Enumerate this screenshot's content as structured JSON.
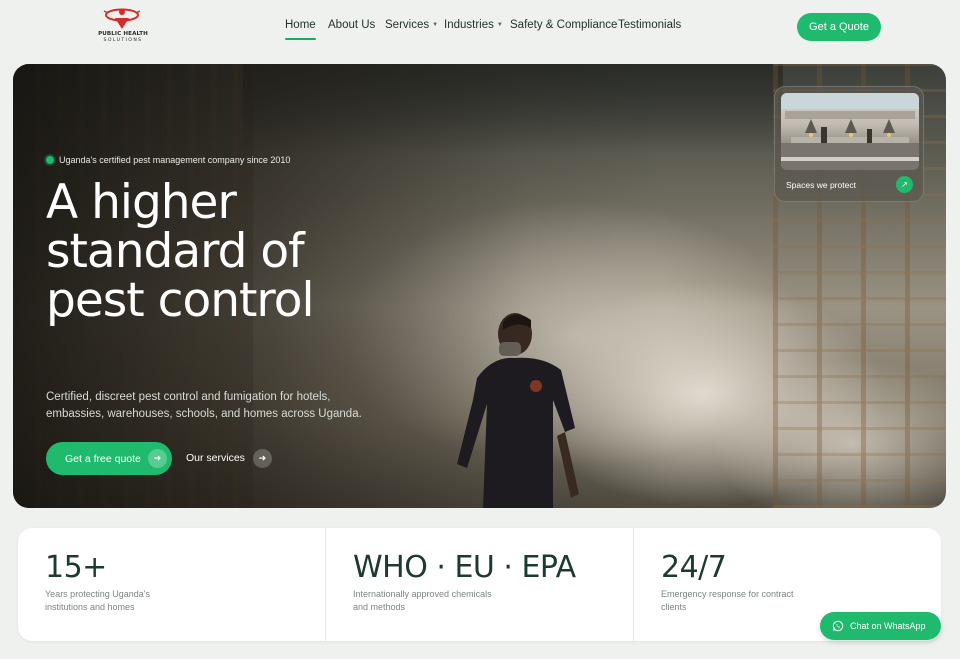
{
  "brand": {
    "logo_line1": "PUBLIC HEALTH",
    "logo_line2": "SOLUTIONS",
    "accent_color": "#1fba6e"
  },
  "nav": {
    "items": [
      {
        "label": "Home",
        "active": true
      },
      {
        "label": "About Us"
      },
      {
        "label": "Services",
        "dropdown": true
      },
      {
        "label": "Industries",
        "dropdown": true
      },
      {
        "label": "Safety & Compliance"
      },
      {
        "label": "Testimonials"
      }
    ],
    "cta_label": "Get a Quote"
  },
  "hero": {
    "badge": "Uganda's certified pest management company since 2010",
    "title": "A higher standard of pest control",
    "subtitle": "Certified, discreet pest control and fumigation for hotels, embassies, warehouses, schools, and homes across Uganda.",
    "primary_cta": "Get a free quote",
    "secondary_cta": "Our services",
    "card_label": "Spaces we protect"
  },
  "stats": [
    {
      "value": "15+",
      "desc": "Years protecting Uganda's institutions and homes"
    },
    {
      "value": "WHO · EU · EPA",
      "desc": "Internationally approved chemicals and methods"
    },
    {
      "value": "24/7",
      "desc": "Emergency response for contract clients"
    }
  ],
  "whatsapp": {
    "label": "Chat on WhatsApp"
  },
  "icons": {
    "arrow_right": "arrow-right-icon",
    "arrow_up_right": "arrow-up-right-icon",
    "whatsapp": "whatsapp-icon",
    "caret": "chevron-down-icon"
  }
}
